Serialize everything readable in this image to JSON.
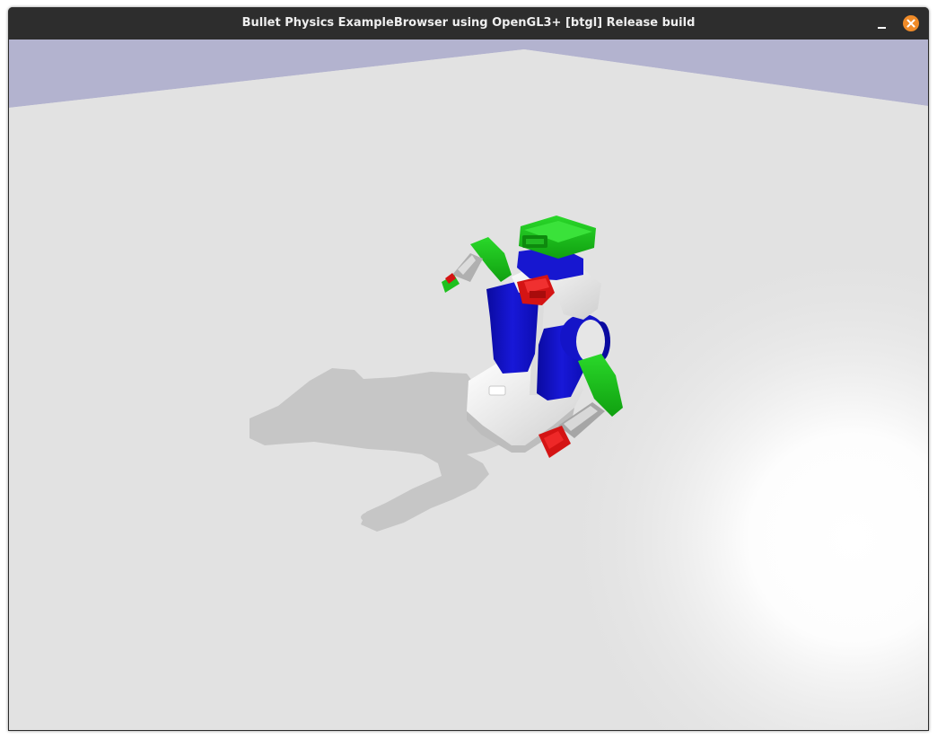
{
  "window": {
    "title": "Bullet Physics ExampleBrowser using OpenGL3+ [btgl] Release build",
    "minimize_label": "Minimize",
    "close_label": "Close"
  },
  "scene": {
    "sky_color": "#b3b3cf",
    "ground_color": "#e2e2e2",
    "shadow_color": "#c6c6c6",
    "robot_colors": {
      "green": "#19c019",
      "blue": "#1212c4",
      "red": "#d41414",
      "white": "#f0f0f0",
      "grey": "#a8a8a8"
    },
    "icons": [
      "minimize-icon",
      "close-icon"
    ]
  }
}
